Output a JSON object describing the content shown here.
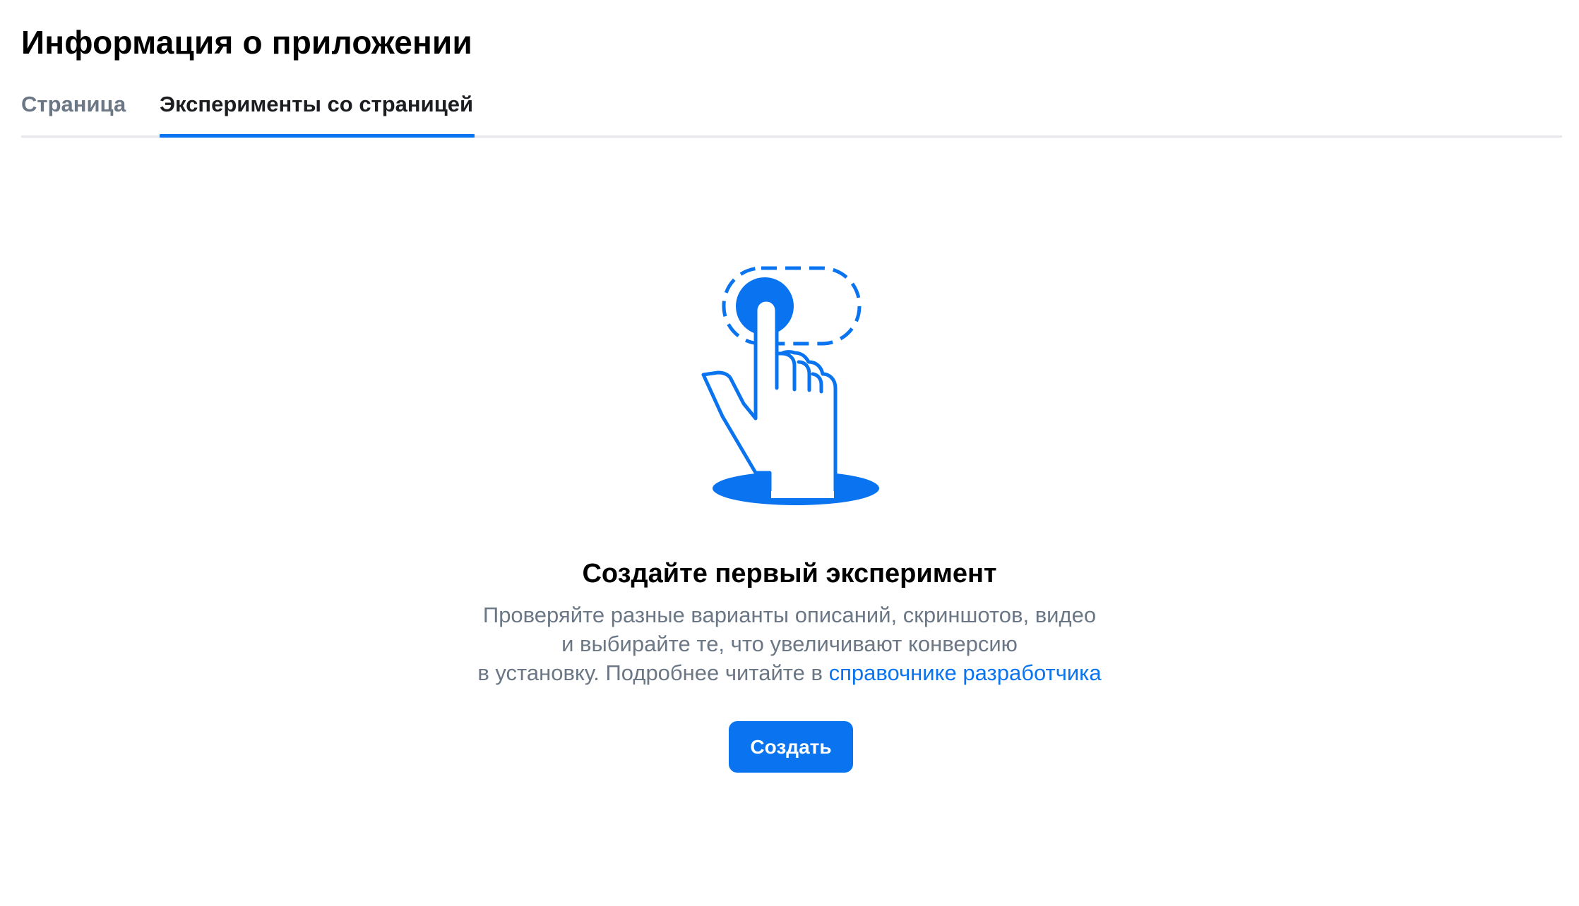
{
  "header": {
    "title": "Информация о приложении"
  },
  "tabs": [
    {
      "label": "Страница",
      "active": false
    },
    {
      "label": "Эксперименты со страницей",
      "active": true
    }
  ],
  "empty_state": {
    "illustration_icon": "hand-pointer-tap-icon",
    "title": "Создайте первый эксперимент",
    "description_line1": "Проверяйте разные варианты описаний, скриншотов, видео",
    "description_line2": "и выбирайте те, что увеличивают конверсию",
    "description_line3_prefix": "в установку. Подробнее читайте в ",
    "link_label": "справочнике разработчика",
    "button_label": "Создать"
  },
  "colors": {
    "accent": "#0a74f0",
    "text_primary": "#000000",
    "text_secondary": "#6b7785",
    "divider": "#e5e7ea"
  }
}
